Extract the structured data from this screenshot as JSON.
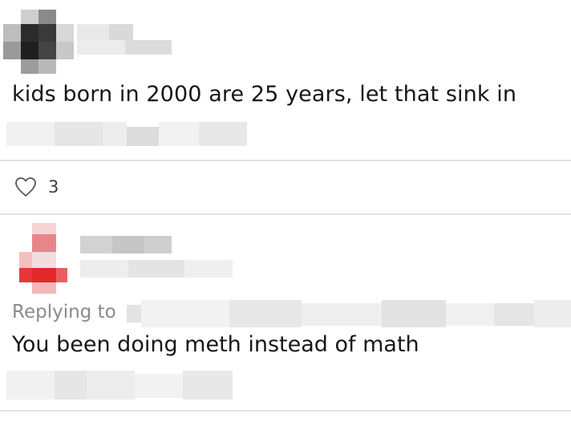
{
  "post": {
    "text": "kids born in 2000 are 25 years, let that sink in",
    "like_count": "3",
    "like_icon": "heart-outline-icon"
  },
  "reply": {
    "replying_to_label": "Replying to",
    "text": "You been doing meth instead of math"
  },
  "colors": {
    "text": "#161616",
    "muted": "#8a8a8a",
    "divider": "#e3e3e3",
    "avatar_accent": "#e8373a"
  }
}
